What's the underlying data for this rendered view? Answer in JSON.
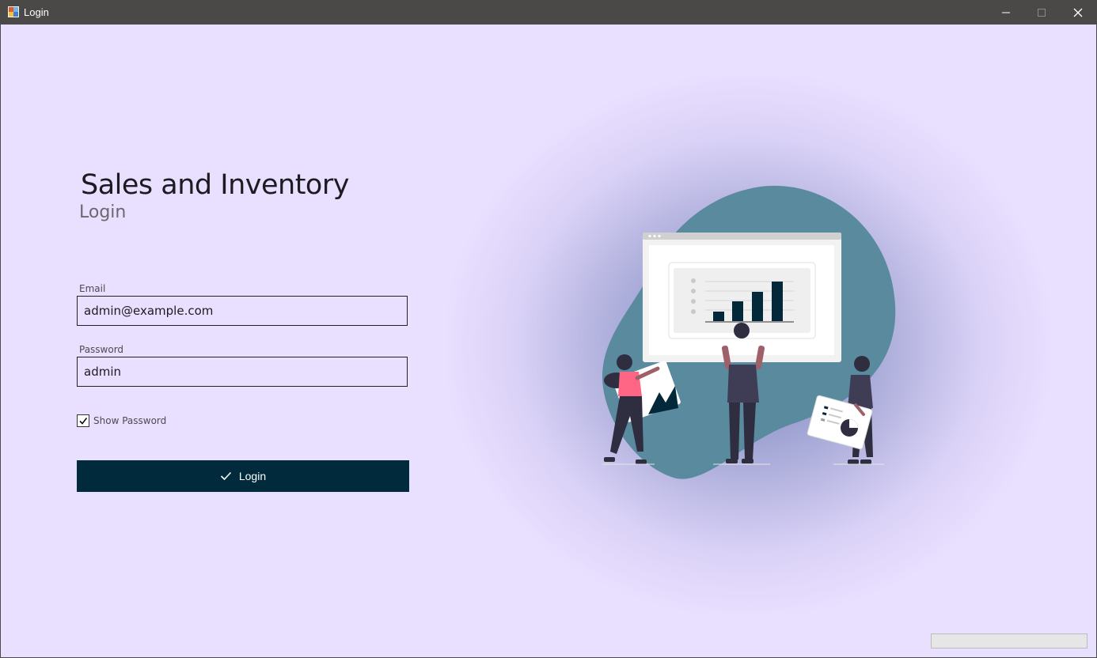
{
  "window": {
    "title": "Login"
  },
  "header": {
    "title": "Sales and Inventory",
    "subtitle": "Login"
  },
  "form": {
    "email_label": "Email",
    "email_value": "admin@example.com",
    "password_label": "Password",
    "password_value": "admin",
    "show_password_label": "Show Password",
    "show_password_checked": true,
    "login_label": "Login"
  },
  "colors": {
    "background": "#e9dfff",
    "button": "#012b3c",
    "titlebar": "#4a4947",
    "blob": "#5a8a9e"
  },
  "icons": {
    "app": "app-icon",
    "login_button": "checkmark-icon",
    "checkbox": "checkmark-icon"
  }
}
